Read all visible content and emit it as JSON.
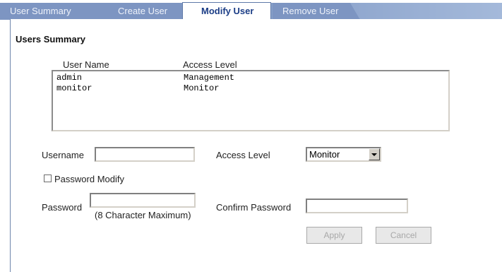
{
  "tabs": [
    {
      "label": "User Summary",
      "active": false
    },
    {
      "label": "Create User",
      "active": false
    },
    {
      "label": "Modify User",
      "active": true
    },
    {
      "label": "Remove User",
      "active": false
    }
  ],
  "summary": {
    "title": "Users Summary",
    "columns": [
      "User Name",
      "Access Level"
    ],
    "rows": [
      {
        "user": "admin",
        "level": "Management"
      },
      {
        "user": "monitor",
        "level": "Monitor"
      }
    ]
  },
  "form": {
    "username_label": "Username",
    "username_value": "",
    "access_level_label": "Access Level",
    "access_level_value": "Monitor",
    "password_modify_label": "Password Modify",
    "password_modify_checked": false,
    "password_label": "Password",
    "password_value": "",
    "password_hint": "(8 Character Maximum)",
    "confirm_password_label": "Confirm Password",
    "confirm_password_value": ""
  },
  "buttons": {
    "apply": "Apply",
    "cancel": "Cancel"
  },
  "colors": {
    "tab_bar": "#7d95c2",
    "active_tab_text": "#1b3d86",
    "panel_border": "#6f86ad"
  }
}
